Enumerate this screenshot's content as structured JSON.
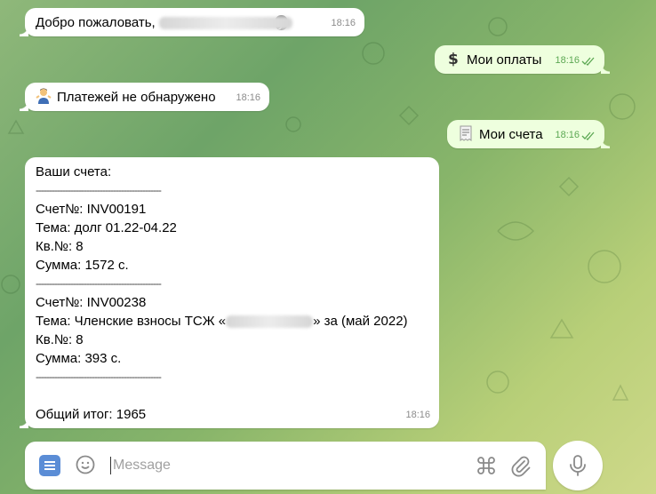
{
  "chat": {
    "messages": [
      {
        "id": "welcome",
        "direction": "in",
        "text": "Добро пожаловать,",
        "time": "18:16",
        "partial_visible": "у"
      },
      {
        "id": "my-payments",
        "direction": "out",
        "icon": "dollar-sign-icon",
        "text": "Мои оплаты",
        "time": "18:16"
      },
      {
        "id": "no-payments",
        "direction": "in",
        "icon": "person-shrug-icon",
        "text": "Платежей не обнаружено",
        "time": "18:16"
      },
      {
        "id": "my-invoices",
        "direction": "out",
        "icon": "receipt-icon",
        "text": "Мои счета",
        "time": "18:16"
      },
      {
        "id": "invoices",
        "direction": "in",
        "time": "18:16",
        "heading": "Ваши счета:",
        "divider": "-----------------------------------------------",
        "invoices": [
          {
            "number": "Счет№: INV00191",
            "topic": "Тема: долг 01.22-04.22",
            "apartment": "Кв.№: 8",
            "amount": "Сумма: 1572 с."
          },
          {
            "number": "Счет№: INV00238",
            "topic_prefix": "Тема: Членские взносы ТСЖ «",
            "topic_suffix": "» за (май 2022)",
            "apartment": "Кв.№: 8",
            "amount": "Сумма: 393 с."
          }
        ],
        "total": "Общий итог: 1965"
      }
    ]
  },
  "composer": {
    "placeholder": "Message"
  },
  "colors": {
    "outgoing_bubble": "#eeffde",
    "incoming_bubble": "#ffffff",
    "check_color": "#5ca853",
    "menu_button": "#5b8dd6"
  }
}
